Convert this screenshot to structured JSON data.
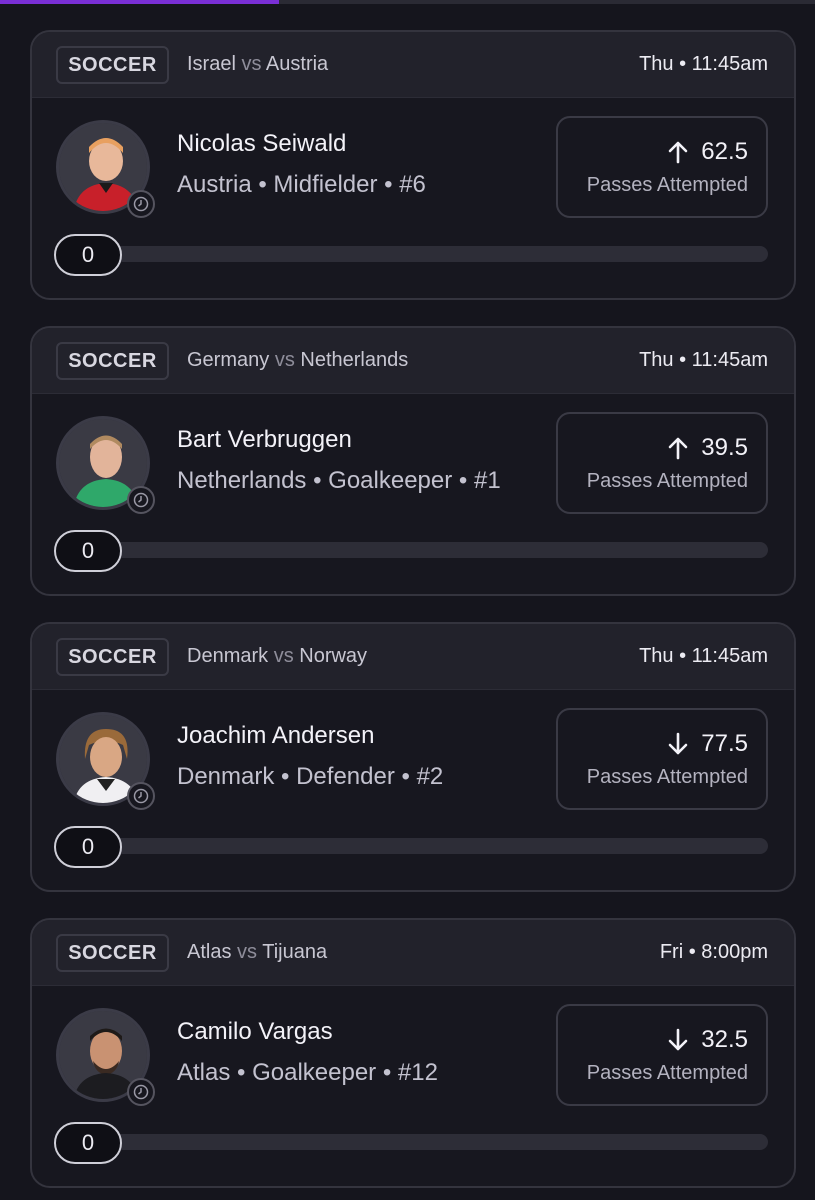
{
  "colors": {
    "accent": "#7a2fd6",
    "background": "#15151d",
    "card": "#17171f",
    "card_header": "#22222b"
  },
  "cards": [
    {
      "sport": "SOCCER",
      "team_a": "Israel",
      "vs": "vs",
      "team_b": "Austria",
      "time": "Thu • 11:45am",
      "player_name": "Nicolas Seiwald",
      "player_info": "Austria • Midfielder • #6",
      "direction_icon": "arrow-up-icon",
      "line": "62.5",
      "stat": "Passes Attempted",
      "progress": "0"
    },
    {
      "sport": "SOCCER",
      "team_a": "Germany",
      "vs": "vs",
      "team_b": "Netherlands",
      "time": "Thu • 11:45am",
      "player_name": "Bart Verbruggen",
      "player_info": "Netherlands • Goalkeeper • #1",
      "direction_icon": "arrow-up-icon",
      "line": "39.5",
      "stat": "Passes Attempted",
      "progress": "0"
    },
    {
      "sport": "SOCCER",
      "team_a": "Denmark",
      "vs": "vs",
      "team_b": "Norway",
      "time": "Thu • 11:45am",
      "player_name": "Joachim Andersen",
      "player_info": "Denmark • Defender • #2",
      "direction_icon": "arrow-down-icon",
      "line": "77.5",
      "stat": "Passes Attempted",
      "progress": "0"
    },
    {
      "sport": "SOCCER",
      "team_a": "Atlas",
      "vs": "vs",
      "team_b": "Tijuana",
      "time": "Fri • 8:00pm",
      "player_name": "Camilo Vargas",
      "player_info": "Atlas • Goalkeeper • #12",
      "direction_icon": "arrow-down-icon",
      "line": "32.5",
      "stat": "Passes Attempted",
      "progress": "0"
    }
  ]
}
